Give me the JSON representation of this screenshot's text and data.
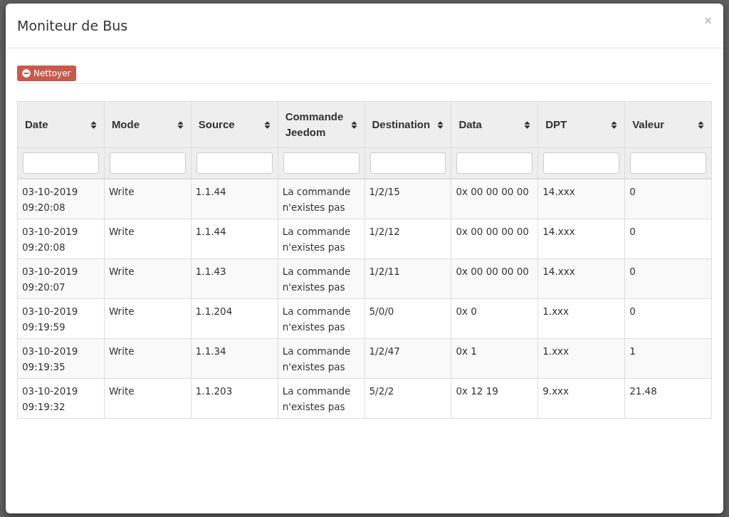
{
  "modal": {
    "title": "Moniteur de Bus",
    "close": "×"
  },
  "toolbar": {
    "clear_button": "Nettoyer"
  },
  "table": {
    "columns": [
      "Date",
      "Mode",
      "Source",
      "Commande Jeedom",
      "Destination",
      "Data",
      "DPT",
      "Valeur"
    ],
    "rows": [
      [
        "03-10-2019 09:20:08",
        "Write",
        "1.1.44",
        "La commande n'existes pas",
        "1/2/15",
        "0x 00 00 00 00",
        "14.xxx",
        "0"
      ],
      [
        "03-10-2019 09:20:08",
        "Write",
        "1.1.44",
        "La commande n'existes pas",
        "1/2/12",
        "0x 00 00 00 00",
        "14.xxx",
        "0"
      ],
      [
        "03-10-2019 09:20:07",
        "Write",
        "1.1.43",
        "La commande n'existes pas",
        "1/2/11",
        "0x 00 00 00 00",
        "14.xxx",
        "0"
      ],
      [
        "03-10-2019 09:19:59",
        "Write",
        "1.1.204",
        "La commande n'existes pas",
        "5/0/0",
        "0x 0",
        "1.xxx",
        "0"
      ],
      [
        "03-10-2019 09:19:35",
        "Write",
        "1.1.34",
        "La commande n'existes pas",
        "1/2/47",
        "0x 1",
        "1.xxx",
        "1"
      ],
      [
        "03-10-2019 09:19:32",
        "Write",
        "1.1.203",
        "La commande n'existes pas",
        "5/2/2",
        "0x 12 19",
        "9.xxx",
        "21.48"
      ]
    ]
  }
}
